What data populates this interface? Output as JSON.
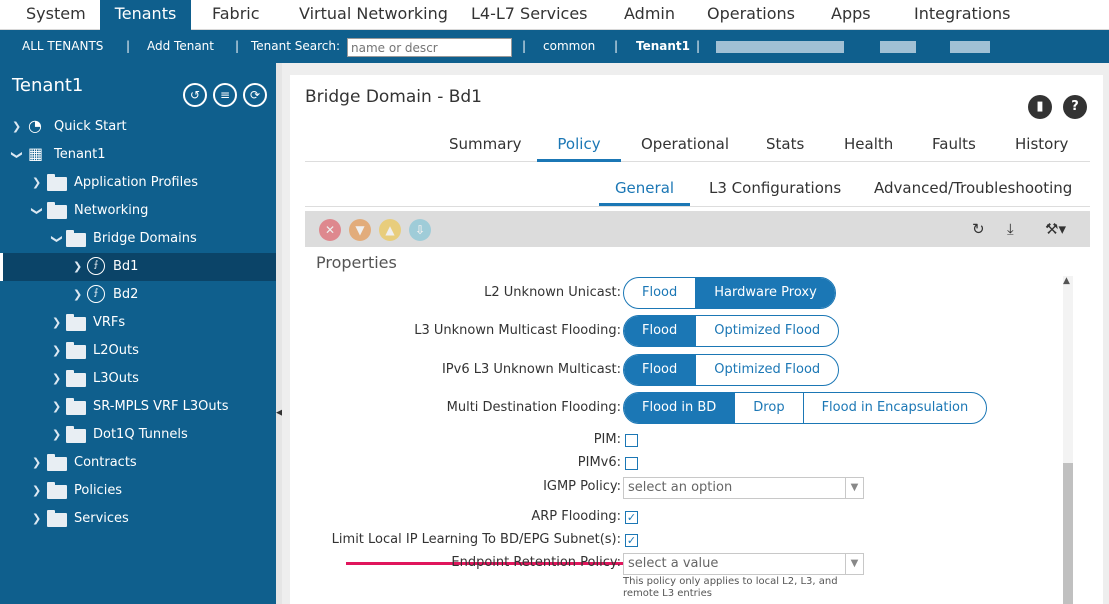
{
  "topnav": {
    "tabs": [
      "System",
      "Tenants",
      "Fabric",
      "Virtual Networking",
      "L4-L7 Services",
      "Admin",
      "Operations",
      "Apps",
      "Integrations"
    ],
    "active": "Tenants"
  },
  "subnav": {
    "all_tenants": "ALL TENANTS",
    "add_tenant": "Add Tenant",
    "search_label": "Tenant Search:",
    "search_placeholder": "name or descr",
    "sep": "|",
    "common": "common",
    "tenant1": "Tenant1"
  },
  "sidebar": {
    "title": "Tenant1",
    "items": [
      {
        "label": "Quick Start"
      },
      {
        "label": "Tenant1"
      },
      {
        "label": "Application Profiles"
      },
      {
        "label": "Networking"
      },
      {
        "label": "Bridge Domains"
      },
      {
        "label": "Bd1"
      },
      {
        "label": "Bd2"
      },
      {
        "label": "VRFs"
      },
      {
        "label": "L2Outs"
      },
      {
        "label": "L3Outs"
      },
      {
        "label": "SR-MPLS VRF L3Outs"
      },
      {
        "label": "Dot1Q Tunnels"
      },
      {
        "label": "Contracts"
      },
      {
        "label": "Policies"
      },
      {
        "label": "Services"
      }
    ]
  },
  "main": {
    "title": "Bridge Domain - Bd1",
    "tabs": [
      "Summary",
      "Policy",
      "Operational",
      "Stats",
      "Health",
      "Faults",
      "History"
    ],
    "active_tab": "Policy",
    "subtabs": [
      "General",
      "L3 Configurations",
      "Advanced/Troubleshooting"
    ],
    "active_subtab": "General",
    "properties_title": "Properties",
    "fields": {
      "l2_unknown_unicast": {
        "label": "L2 Unknown Unicast:",
        "options": [
          "Flood",
          "Hardware Proxy"
        ],
        "selected": "Hardware Proxy"
      },
      "l3_unknown_multicast": {
        "label": "L3 Unknown Multicast Flooding:",
        "options": [
          "Flood",
          "Optimized Flood"
        ],
        "selected": "Flood"
      },
      "ipv6_l3_unknown_multicast": {
        "label": "IPv6 L3 Unknown Multicast:",
        "options": [
          "Flood",
          "Optimized Flood"
        ],
        "selected": "Flood"
      },
      "multi_dest_flooding": {
        "label": "Multi Destination Flooding:",
        "options": [
          "Flood in BD",
          "Drop",
          "Flood in Encapsulation"
        ],
        "selected": "Flood in BD"
      },
      "pim": {
        "label": "PIM:",
        "checked": false
      },
      "pimv6": {
        "label": "PIMv6:",
        "checked": false
      },
      "igmp_policy": {
        "label": "IGMP Policy:",
        "placeholder": "select an option"
      },
      "arp_flooding": {
        "label": "ARP Flooding:",
        "checked": true
      },
      "limit_ip_learning": {
        "label": "Limit Local IP Learning To BD/EPG Subnet(s):",
        "checked": true
      },
      "endpoint_retention": {
        "label": "Endpoint Retention Policy:",
        "placeholder": "select a value",
        "help": "This policy only applies to local L2, L3, and remote L3 entries"
      }
    }
  },
  "colors": {
    "primary": "#0f5f8d",
    "accent": "#1b77b5",
    "highlight": "#e0165c"
  }
}
